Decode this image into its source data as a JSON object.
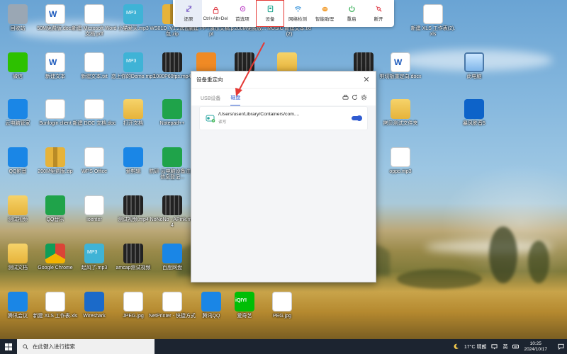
{
  "toolbar": {
    "items": [
      {
        "label": "还原",
        "icon": "restore-icon"
      },
      {
        "label": "Ctrl+Alt+Del",
        "icon": "lock-icon"
      },
      {
        "label": "首选项",
        "icon": "preferences-icon"
      },
      {
        "label": "设备",
        "icon": "device-icon"
      },
      {
        "label": "网络检测",
        "icon": "network-icon"
      },
      {
        "label": "智能助理",
        "icon": "assistant-icon"
      },
      {
        "label": "重启",
        "icon": "power-icon"
      },
      {
        "label": "断开",
        "icon": "disconnect-icon"
      }
    ]
  },
  "dialog": {
    "title": "设备重定向",
    "tabs": [
      "USB设备",
      "磁盘"
    ],
    "active_tab": "磁盘",
    "card": {
      "path": "/Users/user/Library/Containers/com....",
      "access": "读写",
      "enabled": true
    }
  },
  "desktop_icons": [
    {
      "label": "回收站",
      "kind": "gray"
    },
    {
      "label": "50M免费版.docx",
      "kind": "word"
    },
    {
      "label": "新建 Microsoft Word 文档.pdf",
      "kind": "doc"
    },
    {
      "label": "小猫爱天.mp3",
      "kind": "mp3"
    },
    {
      "label": "WS01D_V1.2跨图分包.zip",
      "kind": "zip"
    },
    {
      "label": "新建 PPT演示文稿.ppt",
      "kind": "doc"
    },
    {
      "label": "200M免费版...",
      "kind": "doc"
    },
    {
      "label": "MUSIC 新建文本.txt(2)",
      "kind": "doc"
    },
    {
      "label": "新建 XLS 工作表(2).xls",
      "kind": "doc"
    },
    {
      "label": "微信",
      "kind": "wechat"
    },
    {
      "label": "新建文本",
      "kind": "word"
    },
    {
      "label": "新建文本.txt",
      "kind": "doc"
    },
    {
      "label": "恋上你的Demo.mp3",
      "kind": "mp3"
    },
    {
      "label": "1080P60fps.mp4",
      "kind": "film"
    },
    {
      "label": "P",
      "kind": "orange"
    },
    {
      "label": "video.mp4",
      "kind": "film"
    },
    {
      "label": "folder",
      "kind": "folder"
    },
    {
      "label": "mp4",
      "kind": "film"
    },
    {
      "label": "剪切板重定向.docx",
      "kind": "word"
    },
    {
      "label": "此电脑",
      "kind": "mon"
    },
    {
      "label": "云电脑管家",
      "kind": "app-blue"
    },
    {
      "label": "Sunlogin client",
      "kind": "doc"
    },
    {
      "label": "新建 DOC 文档.doc",
      "kind": "doc"
    },
    {
      "label": "打开文档",
      "kind": "folder"
    },
    {
      "label": "Notepad++",
      "kind": "app-green"
    },
    {
      "label": "拷贝测试文件夹",
      "kind": "folder"
    },
    {
      "label": "暴风影音5",
      "kind": "grid4"
    },
    {
      "label": "QQ影音",
      "kind": "app-blue"
    },
    {
      "label": "200M免费版.zip",
      "kind": "zip"
    },
    {
      "label": "WPS Office",
      "kind": "doc"
    },
    {
      "label": "爱剪辑",
      "kind": "app-blue"
    },
    {
      "label": "航研-云电脑设备注册信息登记...",
      "kind": "app-green"
    },
    {
      "label": "oppo.mp3",
      "kind": "doc"
    },
    {
      "label": "测试视频",
      "kind": "folder"
    },
    {
      "label": "QQ音乐",
      "kind": "app-green"
    },
    {
      "label": "ioenter",
      "kind": "doc"
    },
    {
      "label": "测试视频.mp4",
      "kind": "film"
    },
    {
      "label": "NoNoNo - APink.mp4",
      "kind": "film"
    },
    {
      "label": "测试文档",
      "kind": "folder"
    },
    {
      "label": "Google Chrome",
      "kind": "chrome"
    },
    {
      "label": "起风了.mp3",
      "kind": "mp3"
    },
    {
      "label": "amcap测试视频",
      "kind": "film"
    },
    {
      "label": "百度网盘",
      "kind": "app-blue"
    },
    {
      "label": "腾讯会议",
      "kind": "app-blue"
    },
    {
      "label": "新建 XLS 工作表.xls",
      "kind": "doc"
    },
    {
      "label": "Wireshark",
      "kind": "shark"
    },
    {
      "label": "JPEG.jpg",
      "kind": "doc"
    },
    {
      "label": "NetPrinter - 快捷方式",
      "kind": "doc"
    },
    {
      "label": "腾讯QQ",
      "kind": "app-blue"
    },
    {
      "label": "爱奇艺",
      "kind": "iqiyi"
    },
    {
      "label": "PEG.jpg",
      "kind": "doc"
    }
  ],
  "taskbar": {
    "search_placeholder": "在此键入进行搜索",
    "weather": "17°C 晴朗",
    "ime": "英",
    "time": "10:25",
    "date": "2024/10/17"
  }
}
